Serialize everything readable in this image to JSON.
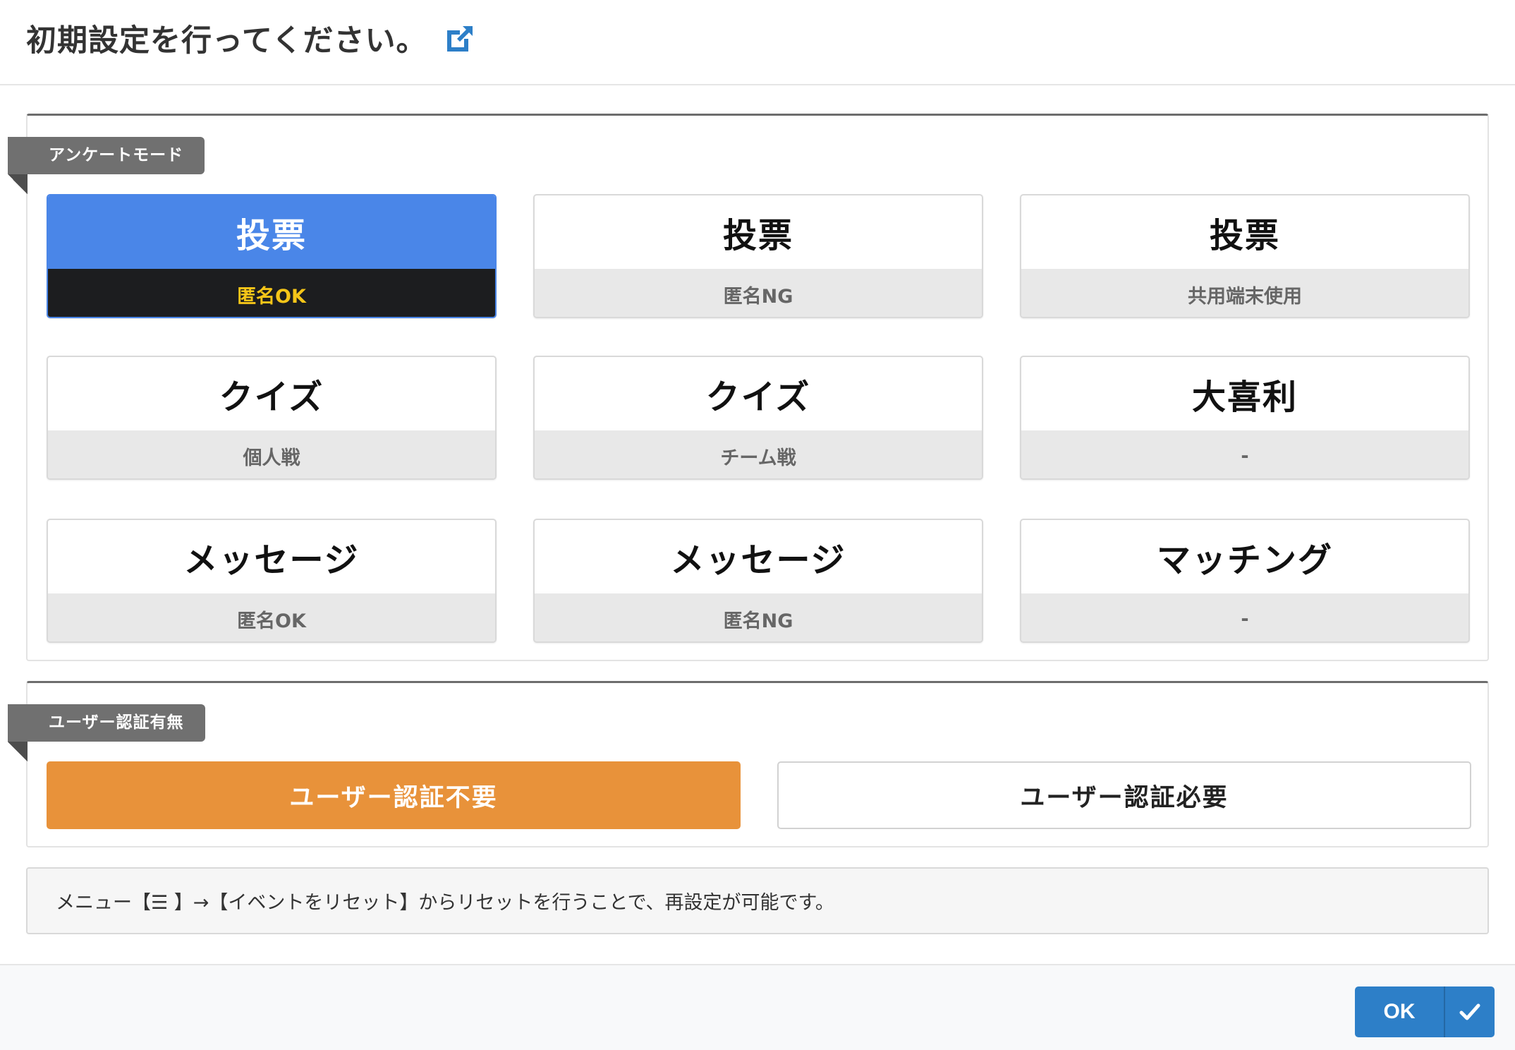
{
  "header": {
    "title": "初期設定を行ってください。",
    "link_icon": "external-link-icon"
  },
  "mode_section": {
    "label": "アンケートモード",
    "cards": [
      {
        "title": "投票",
        "sub": "匿名OK",
        "selected": true
      },
      {
        "title": "投票",
        "sub": "匿名NG",
        "selected": false
      },
      {
        "title": "投票",
        "sub": "共用端末使用",
        "selected": false
      },
      {
        "title": "クイズ",
        "sub": "個人戦",
        "selected": false
      },
      {
        "title": "クイズ",
        "sub": "チーム戦",
        "selected": false
      },
      {
        "title": "大喜利",
        "sub": "-",
        "selected": false
      },
      {
        "title": "メッセージ",
        "sub": "匿名OK",
        "selected": false
      },
      {
        "title": "メッセージ",
        "sub": "匿名NG",
        "selected": false
      },
      {
        "title": "マッチング",
        "sub": "-",
        "selected": false
      }
    ]
  },
  "auth_section": {
    "label": "ユーザー認証有無",
    "options": [
      {
        "label": "ユーザー認証不要",
        "selected": true
      },
      {
        "label": "ユーザー認証必要",
        "selected": false
      }
    ]
  },
  "note": {
    "text": "メニュー【☰ 】→【イベントをリセット】からリセットを行うことで、再設定が可能です。"
  },
  "footer": {
    "ok_label": "OK",
    "ok_icon": "check-icon"
  },
  "colors": {
    "selected_blue": "#4a86e8",
    "selected_orange": "#e8923a",
    "ok_button": "#2d7fc8",
    "selected_sub_text": "#f5c518"
  }
}
